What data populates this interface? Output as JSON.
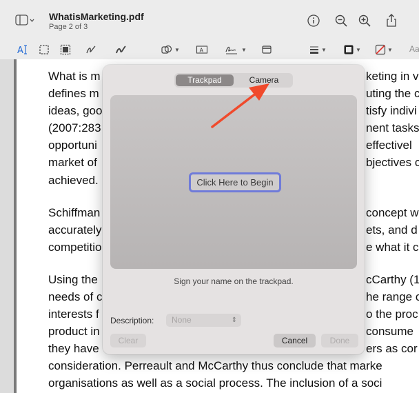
{
  "window": {
    "title": "WhatisMarketing.pdf",
    "subtitle": "Page 2 of 3",
    "toolbar_text_label": "Aa"
  },
  "icons": {
    "sidebar": "sidebar-toggle-icon",
    "info": "info-icon",
    "zoom_out": "zoom-out-icon",
    "zoom_in": "zoom-in-icon",
    "share": "share-icon",
    "text_select": "text-selection-icon",
    "rect_select": "rect-selection-icon",
    "redact": "redact-icon",
    "sketch": "sketch-icon",
    "draw": "draw-icon",
    "shapes": "shapes-icon",
    "text_box": "text-box-icon",
    "sign": "signature-icon",
    "note": "note-icon",
    "line_style": "line-style-icon",
    "border_color": "border-color-icon",
    "fill_color": "fill-color-icon"
  },
  "document": {
    "paragraphs": [
      [
        "What is m",
        "keting in va",
        "defines m",
        "uting the c",
        "ideas, goo",
        "tisfy indivi",
        "(2007:283",
        "nent tasks",
        "opportuni",
        "effectivel",
        "market of",
        "bjectives c",
        "achieved."
      ],
      [
        "Schiffman",
        "concept w",
        "accurately",
        "ets, and d",
        "competitio",
        "e what it c"
      ],
      [
        "Using the",
        "cCarthy (1",
        "needs of c",
        "he range o",
        "interests f",
        "o the proc",
        "product in",
        "consume",
        "they have",
        "ers as cor"
      ],
      [
        "consideration. Perreault and McCarthy thus conclude that marke",
        "organisations as well as a social process. The inclusion of a soci"
      ]
    ]
  },
  "signature_sheet": {
    "tabs": [
      "Trackpad",
      "Camera"
    ],
    "active_tab": "Trackpad",
    "begin_button": "Click Here to Begin",
    "hint": "Sign your name on the trackpad.",
    "description_label": "Description:",
    "description_value": "None",
    "clear_label": "Clear",
    "cancel_label": "Cancel",
    "done_label": "Done"
  },
  "colors": {
    "annotation_arrow": "#f04a2c",
    "focus_ring": "#6f7bd9",
    "toolbar_accent": "#2a6fd6"
  }
}
